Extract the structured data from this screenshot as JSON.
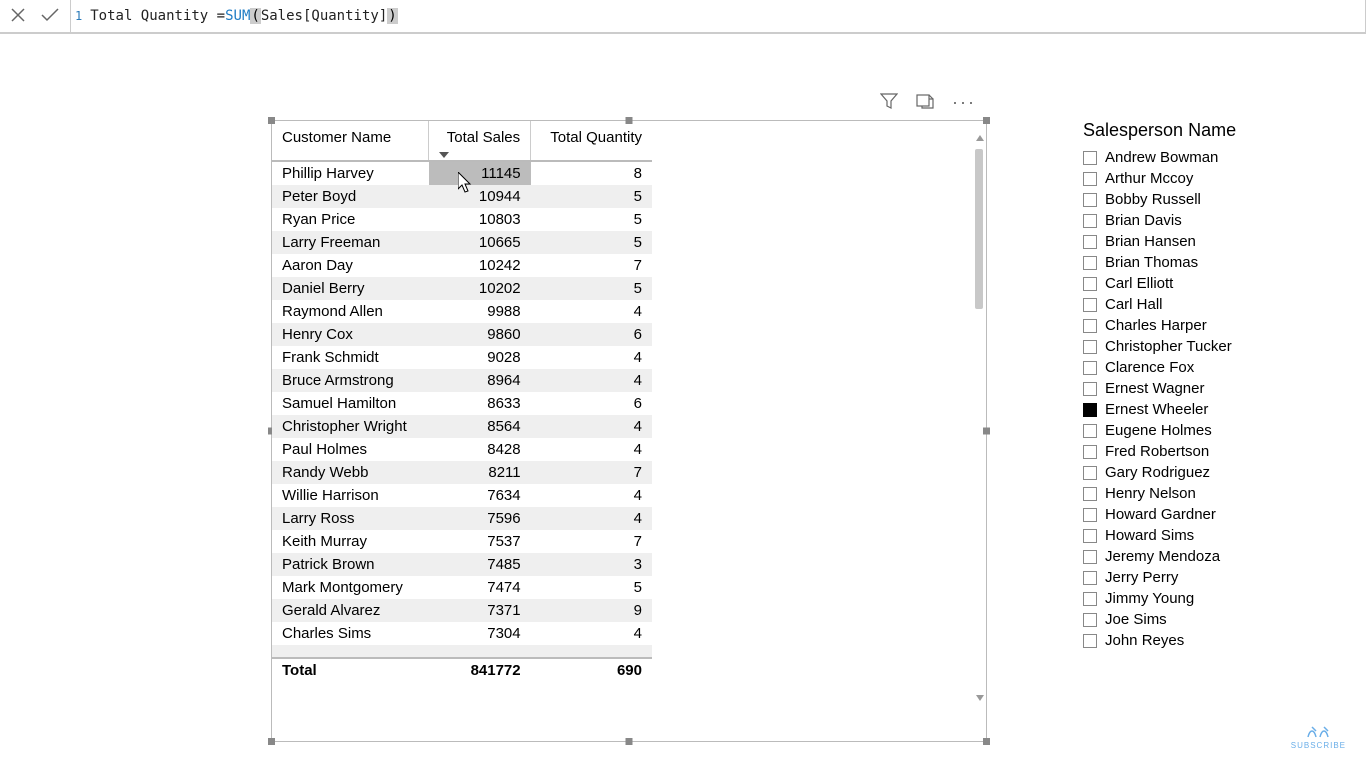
{
  "formula": {
    "line": "1",
    "prefix": "Total Quantity = ",
    "func": "SUM",
    "args": " Sales[Quantity] "
  },
  "table": {
    "columns": [
      "Customer Name",
      "Total Sales",
      "Total Quantity"
    ],
    "rows": [
      {
        "name": "Phillip Harvey",
        "sales": "11145",
        "qty": "8"
      },
      {
        "name": "Peter Boyd",
        "sales": "10944",
        "qty": "5"
      },
      {
        "name": "Ryan Price",
        "sales": "10803",
        "qty": "5"
      },
      {
        "name": "Larry Freeman",
        "sales": "10665",
        "qty": "5"
      },
      {
        "name": "Aaron Day",
        "sales": "10242",
        "qty": "7"
      },
      {
        "name": "Daniel Berry",
        "sales": "10202",
        "qty": "5"
      },
      {
        "name": "Raymond Allen",
        "sales": "9988",
        "qty": "4"
      },
      {
        "name": "Henry Cox",
        "sales": "9860",
        "qty": "6"
      },
      {
        "name": "Frank Schmidt",
        "sales": "9028",
        "qty": "4"
      },
      {
        "name": "Bruce Armstrong",
        "sales": "8964",
        "qty": "4"
      },
      {
        "name": "Samuel Hamilton",
        "sales": "8633",
        "qty": "6"
      },
      {
        "name": "Christopher Wright",
        "sales": "8564",
        "qty": "4"
      },
      {
        "name": "Paul Holmes",
        "sales": "8428",
        "qty": "4"
      },
      {
        "name": "Randy Webb",
        "sales": "8211",
        "qty": "7"
      },
      {
        "name": "Willie Harrison",
        "sales": "7634",
        "qty": "4"
      },
      {
        "name": "Larry Ross",
        "sales": "7596",
        "qty": "4"
      },
      {
        "name": "Keith Murray",
        "sales": "7537",
        "qty": "7"
      },
      {
        "name": "Patrick Brown",
        "sales": "7485",
        "qty": "3"
      },
      {
        "name": "Mark Montgomery",
        "sales": "7474",
        "qty": "5"
      },
      {
        "name": "Gerald Alvarez",
        "sales": "7371",
        "qty": "9"
      },
      {
        "name": "Charles Sims",
        "sales": "7304",
        "qty": "4"
      }
    ],
    "total_label": "Total",
    "total_sales": "841772",
    "total_qty": "690"
  },
  "slicer": {
    "title": "Salesperson Name",
    "items": [
      {
        "label": "Andrew Bowman",
        "checked": false
      },
      {
        "label": "Arthur Mccoy",
        "checked": false
      },
      {
        "label": "Bobby Russell",
        "checked": false
      },
      {
        "label": "Brian Davis",
        "checked": false
      },
      {
        "label": "Brian Hansen",
        "checked": false
      },
      {
        "label": "Brian Thomas",
        "checked": false
      },
      {
        "label": "Carl Elliott",
        "checked": false
      },
      {
        "label": "Carl Hall",
        "checked": false
      },
      {
        "label": "Charles Harper",
        "checked": false
      },
      {
        "label": "Christopher Tucker",
        "checked": false
      },
      {
        "label": "Clarence Fox",
        "checked": false
      },
      {
        "label": "Ernest Wagner",
        "checked": false
      },
      {
        "label": "Ernest Wheeler",
        "checked": true
      },
      {
        "label": "Eugene Holmes",
        "checked": false
      },
      {
        "label": "Fred Robertson",
        "checked": false
      },
      {
        "label": "Gary Rodriguez",
        "checked": false
      },
      {
        "label": "Henry Nelson",
        "checked": false
      },
      {
        "label": "Howard Gardner",
        "checked": false
      },
      {
        "label": "Howard Sims",
        "checked": false
      },
      {
        "label": "Jeremy Mendoza",
        "checked": false
      },
      {
        "label": "Jerry Perry",
        "checked": false
      },
      {
        "label": "Jimmy Young",
        "checked": false
      },
      {
        "label": "Joe Sims",
        "checked": false
      },
      {
        "label": "John Reyes",
        "checked": false
      }
    ]
  },
  "watermark": "SUBSCRIBE"
}
